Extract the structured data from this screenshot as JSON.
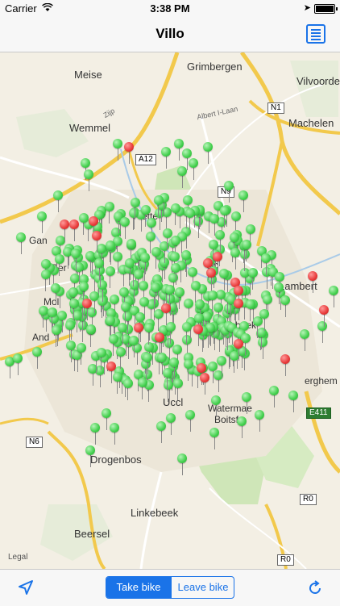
{
  "status_bar": {
    "carrier": "Carrier",
    "time": "3:38 PM"
  },
  "nav": {
    "title": "Villo"
  },
  "map": {
    "legal": "Legal",
    "places": {
      "grimbergen": "Grimbergen",
      "meise": "Meise",
      "vilvoorde": "Vilvoorde",
      "machelen": "Machelen",
      "wemmel": "Wemmel",
      "lambert": "Lambert",
      "zip": "Zijp",
      "albert": "Albert I-Laan",
      "beek": "beek",
      "ucc": "Uccl",
      "watermael": "Watermae",
      "boitsf": "Boitsf",
      "drogenbos": "Drogenbos",
      "linkebeek": "Linkebeek",
      "beersel": "Beersel",
      "erghem": "erghem",
      "mol": "Mol",
      "and": "And",
      "gan": "Gan",
      "ber": "Ber",
      "ette": "ette",
      "scha": "Sc"
    },
    "road_shields": {
      "a12": "A12",
      "n1": "N1",
      "n9": "N9",
      "n6": "N6",
      "e411": "E411",
      "r0_a": "R0",
      "r0_b": "R0"
    },
    "pin_colors": {
      "green": "#42cf4c",
      "red": "#e83a3a"
    }
  },
  "toolbar": {
    "take_bike": "Take bike",
    "leave_bike": "Leave bike",
    "selected": "Take bike"
  }
}
